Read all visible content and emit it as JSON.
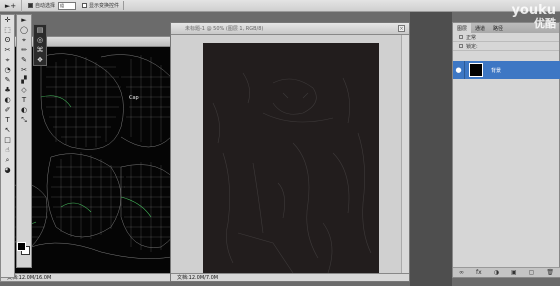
{
  "options_bar": {
    "move_tool_symbol": "►+",
    "auto_select_label": "自动选择",
    "auto_select_value": "组",
    "show_transform_label": "显示变换控件"
  },
  "toolbox": {
    "tools_col1": [
      "✛",
      "⬚",
      "ʘ",
      "✂",
      "⌖",
      "◔",
      "✎",
      "♣",
      "◐",
      "✐",
      "T",
      "↖",
      "□",
      "☝",
      "⌕",
      "◕"
    ],
    "tools_col2": [
      "►",
      "◯",
      "⌖",
      "✏",
      "✎",
      "✂",
      "▞",
      "◇",
      "T",
      "◐",
      "⤡"
    ],
    "tools_col3": [
      "▤",
      "◎",
      "⌘",
      "❖"
    ]
  },
  "doc_left": {
    "status": "文档:12.0M/16.0M"
  },
  "doc_main": {
    "title": "未标题-1 @ 50% (图层 1, RGB/8)",
    "close_symbol": "×",
    "status": "文档:12.0M/7.0M"
  },
  "layers_panel": {
    "tabs": [
      "图层",
      "通道",
      "路径"
    ],
    "active_tab": 0,
    "rows": [
      "正常",
      "锁定:"
    ],
    "layer_name": "背景",
    "footer_icons": [
      "∞",
      "fx",
      "◑",
      "▣",
      "▢",
      "🗑"
    ]
  },
  "watermark": {
    "brand_en": "youku",
    "brand_cn": "优酷"
  }
}
